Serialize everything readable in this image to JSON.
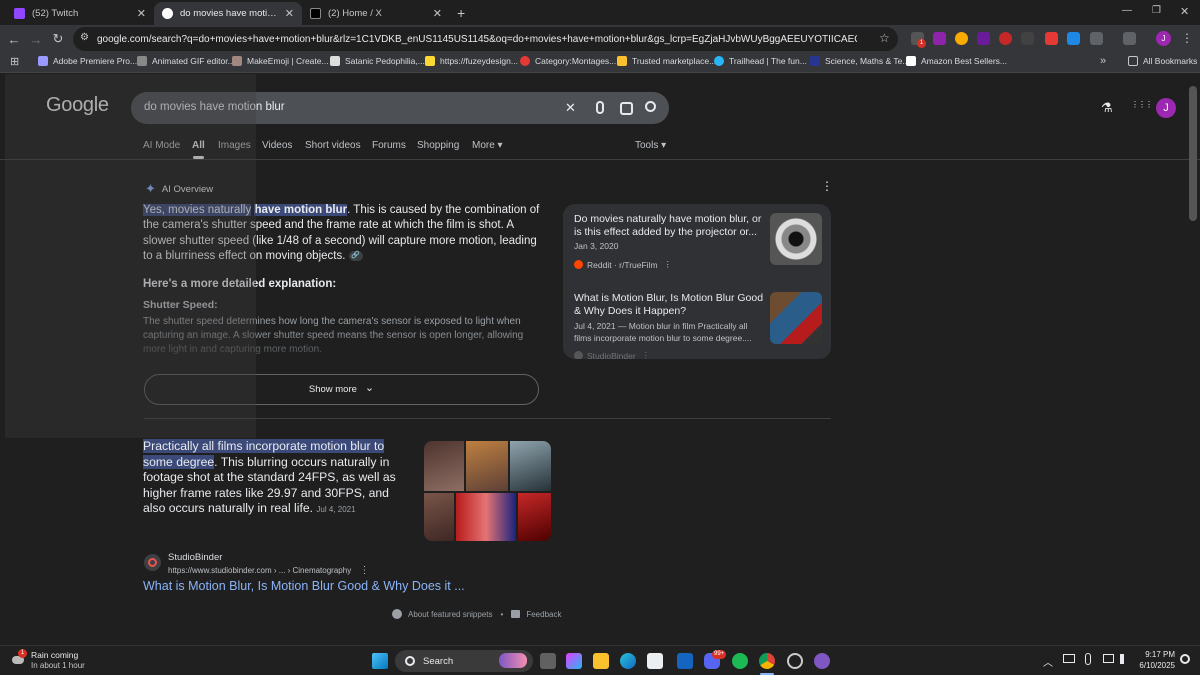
{
  "tabs": [
    {
      "title": "(52) Twitch",
      "close": "✕"
    },
    {
      "title": "do movies have motion blur - G",
      "close": "✕"
    },
    {
      "title": "(2) Home / X",
      "close": "✕"
    }
  ],
  "new_tab": "+",
  "window": {
    "minimize": "—",
    "restore": "❐",
    "close": "✕"
  },
  "toolbar": {
    "back": "←",
    "forward": "→",
    "reload": "↻",
    "site_info": "⚙",
    "url": "google.com/search?q=do+movies+have+motion+blur&rlz=1C1VDKB_enUS1145US1145&oq=do+movies+have+motion+blur&gs_lcrp=EgZjaHJvbWUyBggAEEUYOTIICAEQABgWGB4yDQgCEAAYhg...",
    "star": "☆",
    "profile": "J",
    "menu": "⋮",
    "ext_badge": "1"
  },
  "bookmarks": {
    "apps": "⊞",
    "items": [
      "Adobe Premiere Pro...",
      "Animated GIF editor...",
      "MakeEmoji | Create...",
      "Satanic Pedophilia,...",
      "https://fuzeydesign...",
      "Category:Montages...",
      "Trusted marketplace...",
      "Trailhead | The fun...",
      "Science, Maths & Te...",
      "Amazon Best Sellers..."
    ],
    "overflow": "»",
    "all": "All Bookmarks"
  },
  "google": {
    "logo": "Google",
    "query": "do movies have motion blur",
    "clear": "✕",
    "labs": "⚗",
    "apps": "⋮⋮⋮",
    "avatar": "J",
    "tabs": [
      "AI Mode",
      "All",
      "Images",
      "Videos",
      "Short videos",
      "Forums",
      "Shopping",
      "More ▾"
    ],
    "tools": "Tools ▾"
  },
  "ai_overview": {
    "heading": "AI Overview",
    "kebab": "⋮",
    "highlight1": "Yes, movies naturally",
    "highlight2": "have motion blur",
    "body": ". This is caused by the combination of the camera's shutter speed and the frame rate at which the film is shot. A slower shutter speed (like 1/48 of a second) will capture more motion, leading to a blurriness effect on moving objects.",
    "link_chip": "🔗",
    "more_heading": "Here's a more detailed explanation:",
    "shutter_label": "Shutter Speed:",
    "shutter_text": "The shutter speed determines how long the camera's sensor is exposed to light when capturing an image. A slower shutter speed means the sensor is open longer, allowing more light in and capturing more motion.",
    "show_more": "Show more",
    "chevron": "⌄"
  },
  "sources": [
    {
      "title": "Do movies naturally have motion blur, or is this effect added by the projector or...",
      "date": "Jan 3, 2020",
      "site": "Reddit · r/TrueFilm",
      "kebab": "⋮"
    },
    {
      "title": "What is Motion Blur, Is Motion Blur Good & Why Does it Happen?",
      "date": "Jul 4, 2021 — Motion blur in film Practically all films incorporate motion blur to some degree....",
      "site": "StudioBinder",
      "kebab": "⋮"
    }
  ],
  "featured_snippet": {
    "highlight": "Practically all films incorporate motion blur to some degree",
    "body": ". This blurring occurs naturally in footage shot at the standard 24FPS, as well as higher frame rates like 29.97 and 30FPS, and also occurs naturally in real life.",
    "date": "Jul 4, 2021",
    "site": "StudioBinder",
    "url": "https://www.studiobinder.com › ... › Cinematography",
    "kebab": "⋮",
    "title": "What is Motion Blur, Is Motion Blur Good & Why Does it ...",
    "about": "About featured snippets",
    "sep": "•",
    "feedback": "Feedback"
  },
  "taskbar": {
    "weather_title": "Rain coming",
    "weather_sub": "In about 1 hour",
    "weather_badge": "1",
    "search": "Search",
    "time": "9:17 PM",
    "date": "6/10/2025",
    "discord_badge": "99+"
  },
  "colors": {
    "accent": "#8ab4f8",
    "highlight": "#3c4a7a",
    "avatar": "#9c27b0"
  }
}
